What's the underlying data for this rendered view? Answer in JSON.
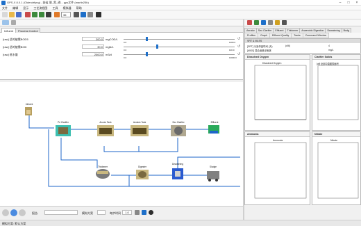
{
  "window": {
    "title": "GPS-X 8.0.1 (Oldendrfyng) - 缺省-脱_氮_磷... gps文件 (martin25b)"
  },
  "menu": [
    "文件",
    "编辑",
    "显示",
    "工艺流程图",
    "工具",
    "模拟器",
    "帮助"
  ],
  "toolbar": {
    "zoom": "36"
  },
  "left_tabs": [
    "Influent",
    "Process Control"
  ],
  "params": [
    {
      "label": "[raw] 总的被需BOD5",
      "value": "200.0",
      "unit": "mgCOD/L",
      "knob": 0.2,
      "min": "0.0",
      "max": "1000.0"
    },
    {
      "label": "[raw] 总的被需BOD",
      "value": "30.0",
      "unit": "mgN/L",
      "knob": 0.3,
      "min": "0.0",
      "max": "100.0"
    },
    {
      "label": "[raw] 进水量",
      "value": "2000.0",
      "unit": "m3/d",
      "knob": 0.2,
      "min": "0.0",
      "max": "10000.0"
    }
  ],
  "flow": {
    "influent": "Influent",
    "pri": "Pri Clarifier",
    "anoxic": "Anoxic Tank",
    "aerobic": "Aerobic Tank",
    "sec": "Sec Clarifier",
    "effluent": "Effluent",
    "thickener": "Thickener",
    "digester": "Digester",
    "dewatering": "Dewatering",
    "sludge": "Sludge"
  },
  "bottom": {
    "log_label": "报告:",
    "speed_label": "模拟方案",
    "step_label": "每步时间",
    "step_value": "1.0"
  },
  "status": "模拟方案: 默认方案",
  "right": {
    "top_tabs": [
      "Aerator",
      "Sec Clarifier",
      "Effluent",
      "Thickener",
      "Anaerobic Digestion",
      "Dewatering",
      "Budg"
    ],
    "sub_tabs": [
      "Profiles",
      "Graph",
      "Effluent Quality",
      "Tanks",
      "Command Window"
    ],
    "info_title": "SRT & MLSS",
    "info_rows": [
      {
        "label": "[SRT] 污泥停留时间 (天)",
        "v1": "(d/6)",
        "v2": "4"
      },
      {
        "label": "[MISS] 混合液悬浮固体",
        "v1": "",
        "v2": "mg/L"
      }
    ],
    "panels": [
      {
        "title": "Dissolved Oxygen",
        "chart": "Dissolved Oxygen"
      },
      {
        "title": "Clarifier Solids",
        "chart": "[off] 全部中直图表面积"
      },
      {
        "title": "Ammonia",
        "chart": "Ammonia"
      },
      {
        "title": "Nitrate",
        "chart": "Nitrate"
      }
    ]
  }
}
